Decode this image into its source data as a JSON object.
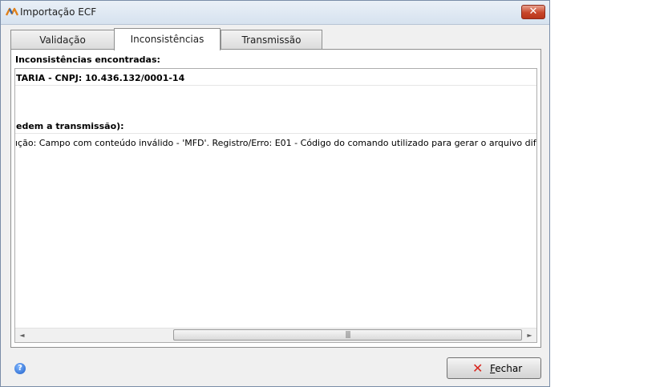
{
  "window": {
    "title": "Importação ECF"
  },
  "tabs": [
    {
      "label": "Validação"
    },
    {
      "label": "Inconsistências"
    },
    {
      "label": "Transmissão"
    }
  ],
  "panel": {
    "section_label": "Inconsistências encontradas:",
    "rows": [
      {
        "text": "TARIA - CNPJ: 10.436.132/0001-14"
      },
      {
        "text": "edem a transmissão):"
      },
      {
        "text": "ıção: Campo com conteúdo inválido - 'MFD'. Registro/Erro: E01 - Código do comando utilizado para gerar o arquivo difere de TDM."
      }
    ]
  },
  "scrollbar": {
    "left_arrow": "◄",
    "right_arrow": "►",
    "grip": "|||"
  },
  "footer": {
    "help_icon_glyph": "?",
    "close_icon_glyph": "✕",
    "fechar_first": "F",
    "fechar_rest": "echar"
  }
}
